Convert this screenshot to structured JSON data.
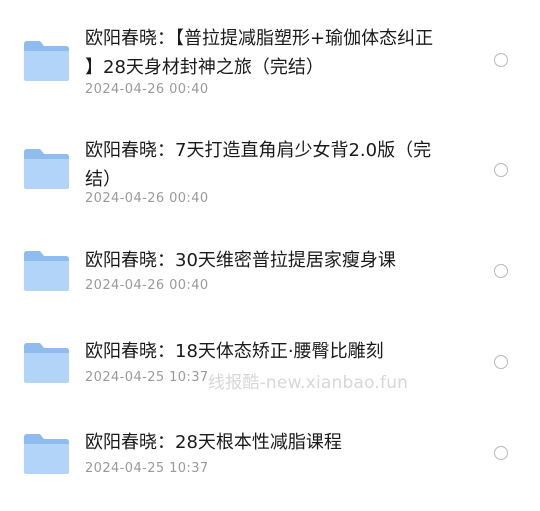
{
  "files": [
    {
      "name": "欧阳春晓：【普拉提减脂塑形+瑜伽体态纠正 】28天身材封神之旅（完结）",
      "date": "2024-04-26 00:40",
      "icon": "folder-icon"
    },
    {
      "name": "欧阳春晓：7天打造直角肩少女背2.0版（完结）",
      "date": "2024-04-26 00:40",
      "icon": "folder-icon"
    },
    {
      "name": "欧阳春晓：30天维密普拉提居家瘦身课",
      "date": "2024-04-26 00:40",
      "icon": "folder-icon"
    },
    {
      "name": "欧阳春晓：18天体态矫正·腰臀比雕刻",
      "date": "2024-04-25 10:37",
      "icon": "folder-icon"
    },
    {
      "name": "欧阳春晓：28天根本性减脂课程",
      "date": "2024-04-25 10:37",
      "icon": "folder-icon"
    }
  ],
  "watermark": "线报酷-new.xianbao.fun",
  "colors": {
    "folder_body": "#9cc4f2",
    "folder_front": "#b6d6fa",
    "text": "#1a1a1a",
    "date": "#9a9a9a",
    "radio_border": "#b8b8b8"
  }
}
